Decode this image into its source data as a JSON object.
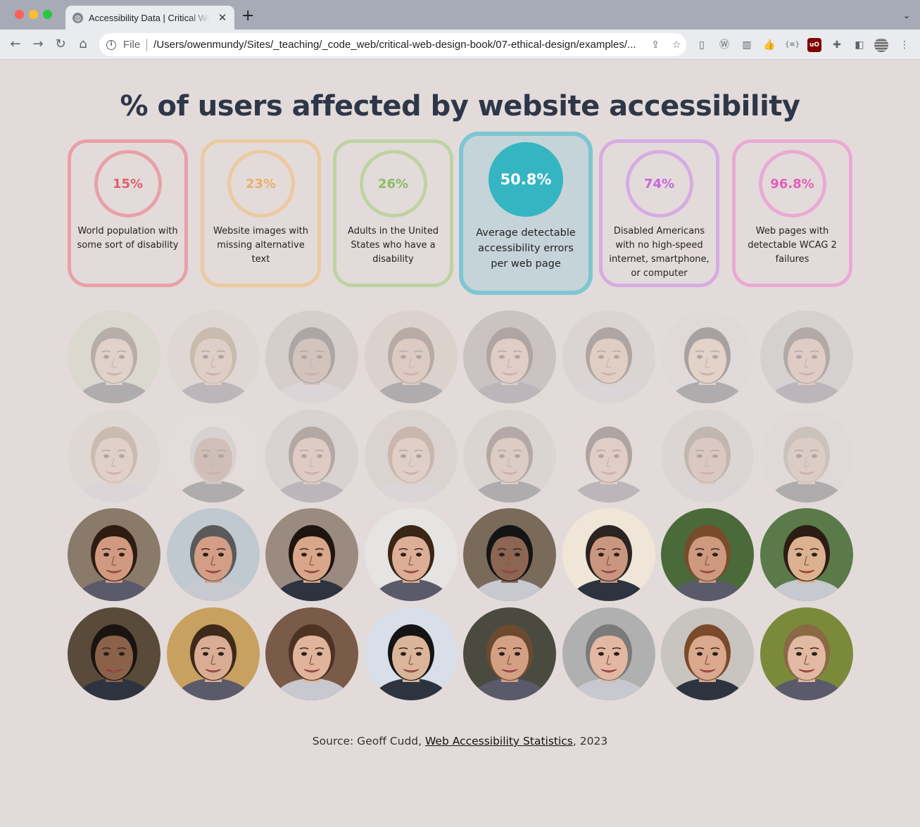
{
  "browser": {
    "tab_title": "Accessibility Data | Critical Web Design",
    "url_scheme": "File",
    "url": "/Users/owenmundy/Sites/_teaching/_code_web/critical-web-design-book/07-ethical-design/examples/..."
  },
  "page": {
    "title": "% of users affected by website accessibility"
  },
  "stats": [
    {
      "value": "15%",
      "label": "World population with some sort of disability",
      "color": "#e8a1a8",
      "text_color": "#e0606c"
    },
    {
      "value": "23%",
      "label": "Website images with missing alternative text",
      "color": "#ecc9a0",
      "text_color": "#e9b06b"
    },
    {
      "value": "26%",
      "label": "Adults in the United States who have a disability",
      "color": "#bdd3a2",
      "text_color": "#8dbb62"
    },
    {
      "value": "50.8%",
      "label": "Average detectable accessibility errors per web page",
      "color": "#7dc6d2",
      "text_color": "#ffffff"
    },
    {
      "value": "74%",
      "label": "Disabled Americans with no high-speed internet, smartphone, or computer",
      "color": "#d8abe3",
      "text_color": "#c865df"
    },
    {
      "value": "96.8%",
      "label": "Web pages with detectable WCAG 2 failures",
      "color": "#eaa9d4",
      "text_color": "#e35fb8"
    }
  ],
  "faces": {
    "faded_count": 16,
    "total": 32,
    "skin_tones": [
      "#d9b89e",
      "#d7b094",
      "#a98670",
      "#d0a48a",
      "#d9ac93",
      "#d9ad8f",
      "#e2bc9c",
      "#d6a88d",
      "#dcb69c",
      "#9e7a62",
      "#d2a98e",
      "#dbb299",
      "#cfa88e",
      "#d7ab94",
      "#c99c83",
      "#c9a791",
      "#d19a80",
      "#d49e86",
      "#d8a789",
      "#dcae95",
      "#8c6553",
      "#c9977f",
      "#ce9a7f",
      "#dcb18f",
      "#8b6249",
      "#d9ad94",
      "#e0b49b",
      "#dbb59a",
      "#d4a084",
      "#e3b7a1",
      "#d9a88d",
      "#e2b9a2"
    ],
    "hair_colors": [
      "#4a3a2c",
      "#8a6a3c",
      "#222",
      "#4b3323",
      "#2b1c16",
      "#2b2018",
      "#111",
      "#3a2d25",
      "#8b6a45",
      "#bbb",
      "#3a2618",
      "#8a5a3a",
      "#3c2c22",
      "#2a1c16",
      "#6d5a48",
      "#8e8478",
      "#2e1c12",
      "#5a5a5a",
      "#1e1511",
      "#3a2516",
      "#141414",
      "#2b2420",
      "#7a4b2a",
      "#2c1d14",
      "#1a1410",
      "#3e2a1a",
      "#4d3323",
      "#141414",
      "#6b4a30",
      "#7a7a7a",
      "#7a4a2a",
      "#8a6a45"
    ],
    "bg_colors": [
      "#c9d1b8",
      "#d6cfc8",
      "#b8b0a8",
      "#c8bcb0",
      "#8b8886",
      "#c4c4c4",
      "#d8d8d8",
      "#b4b8bc",
      "#d5d0c8",
      "#e4e2e0",
      "#bfc2bc",
      "#c4bfb6",
      "#c8c6c0",
      "#e0dcd8",
      "#c8c8c8",
      "#d6d6d6",
      "#8a7a6a",
      "#c0c8d0",
      "#9a8a80",
      "#e6e4e2",
      "#7a6a5a",
      "#efe6d8",
      "#4a6a3a",
      "#5a7a4a",
      "#5a4a3a",
      "#c8a060",
      "#7a5a48",
      "#d8dfe8",
      "#4a4a40",
      "#b0b0b0",
      "#c8c4c0",
      "#7a8a3a"
    ]
  },
  "source": {
    "prefix": "Source: Geoff Cudd, ",
    "link_text": "Web Accessibility Statistics",
    "suffix": ", 2023"
  }
}
